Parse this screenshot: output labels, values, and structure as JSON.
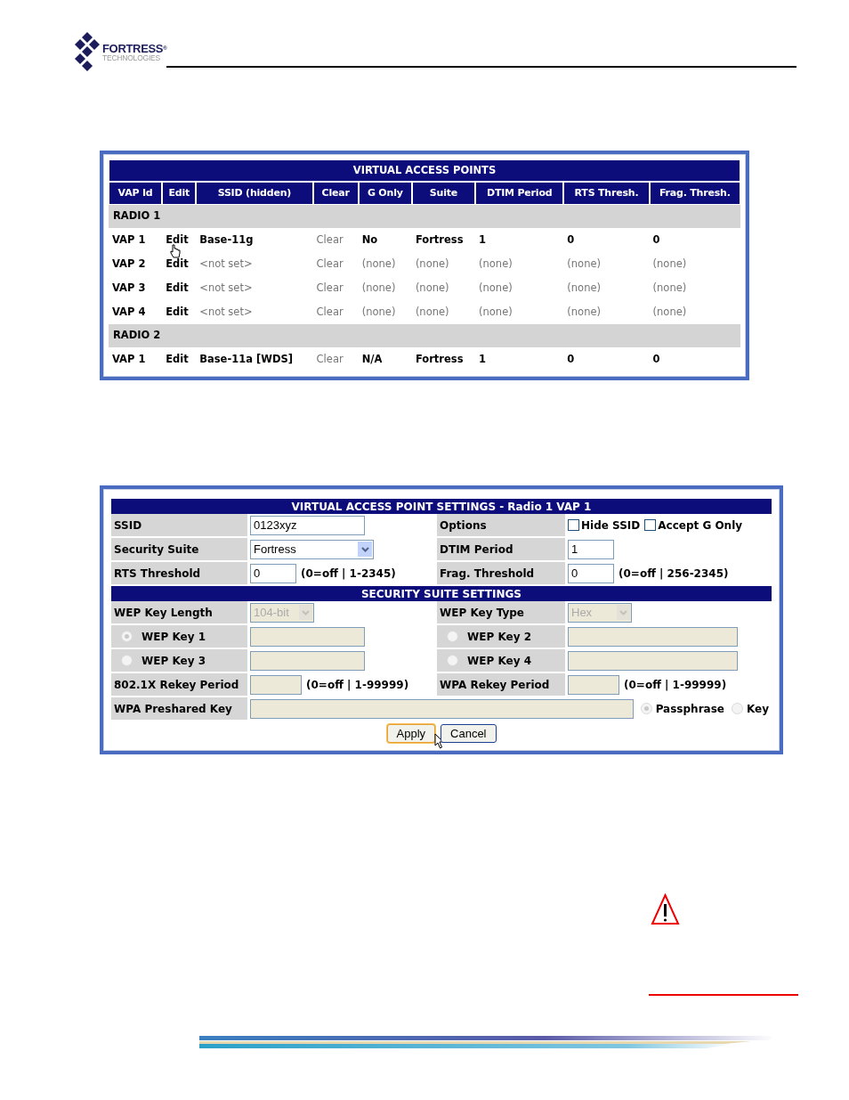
{
  "header": {
    "brand": "FORTRESS",
    "registered": "®",
    "tagline": "TECHNOLOGIES"
  },
  "vap_table": {
    "title": "VIRTUAL ACCESS POINTS",
    "columns": [
      "VAP Id",
      "Edit",
      "SSID (hidden)",
      "Clear",
      "G Only",
      "Suite",
      "DTIM Period",
      "RTS Thresh.",
      "Frag. Thresh."
    ],
    "groups": [
      {
        "label": "RADIO 1",
        "rows": [
          {
            "cells": [
              {
                "text": "VAP 1",
                "dimmed": false
              },
              {
                "text": "Edit",
                "dimmed": false
              },
              {
                "text": "Base-11g",
                "dimmed": false
              },
              {
                "text": "Clear",
                "dimmed": true
              },
              {
                "text": "No",
                "dimmed": false
              },
              {
                "text": "Fortress",
                "dimmed": false
              },
              {
                "text": "1",
                "dimmed": false
              },
              {
                "text": "0",
                "dimmed": false
              },
              {
                "text": "0",
                "dimmed": false
              }
            ]
          },
          {
            "cells": [
              {
                "text": "VAP 2",
                "dimmed": false
              },
              {
                "text": "Edit",
                "dimmed": false
              },
              {
                "text": "<not set>",
                "dimmed": true
              },
              {
                "text": "Clear",
                "dimmed": true
              },
              {
                "text": "(none)",
                "dimmed": true
              },
              {
                "text": "(none)",
                "dimmed": true
              },
              {
                "text": "(none)",
                "dimmed": true
              },
              {
                "text": "(none)",
                "dimmed": true
              },
              {
                "text": "(none)",
                "dimmed": true
              }
            ]
          },
          {
            "cells": [
              {
                "text": "VAP 3",
                "dimmed": false
              },
              {
                "text": "Edit",
                "dimmed": false
              },
              {
                "text": "<not set>",
                "dimmed": true
              },
              {
                "text": "Clear",
                "dimmed": true
              },
              {
                "text": "(none)",
                "dimmed": true
              },
              {
                "text": "(none)",
                "dimmed": true
              },
              {
                "text": "(none)",
                "dimmed": true
              },
              {
                "text": "(none)",
                "dimmed": true
              },
              {
                "text": "(none)",
                "dimmed": true
              }
            ]
          },
          {
            "cells": [
              {
                "text": "VAP 4",
                "dimmed": false
              },
              {
                "text": "Edit",
                "dimmed": false
              },
              {
                "text": "<not set>",
                "dimmed": true
              },
              {
                "text": "Clear",
                "dimmed": true
              },
              {
                "text": "(none)",
                "dimmed": true
              },
              {
                "text": "(none)",
                "dimmed": true
              },
              {
                "text": "(none)",
                "dimmed": true
              },
              {
                "text": "(none)",
                "dimmed": true
              },
              {
                "text": "(none)",
                "dimmed": true
              }
            ]
          }
        ]
      },
      {
        "label": "RADIO 2",
        "rows": [
          {
            "cells": [
              {
                "text": "VAP 1",
                "dimmed": false
              },
              {
                "text": "Edit",
                "dimmed": false
              },
              {
                "text": "Base-11a [WDS]",
                "dimmed": false
              },
              {
                "text": "Clear",
                "dimmed": true
              },
              {
                "text": "N/A",
                "dimmed": false
              },
              {
                "text": "Fortress",
                "dimmed": false
              },
              {
                "text": "1",
                "dimmed": false
              },
              {
                "text": "0",
                "dimmed": false
              },
              {
                "text": "0",
                "dimmed": false
              }
            ]
          }
        ]
      }
    ]
  },
  "settings": {
    "rows": [
      {
        "kind": "heading",
        "text": "VIRTUAL ACCESS POINT SETTINGS - Radio 1 VAP 1"
      },
      {
        "kind": "pair",
        "left": {
          "label": "SSID",
          "control": {
            "kind": "input",
            "value": "0123xyz",
            "disabled": false
          }
        },
        "right": {
          "label": "Options",
          "control": {
            "kind": "checks",
            "options": [
              {
                "label": "Hide SSID",
                "checked": false
              },
              {
                "label": "Accept G Only",
                "checked": false
              }
            ]
          }
        }
      },
      {
        "kind": "pair",
        "left": {
          "label": "Security Suite",
          "control": {
            "kind": "select",
            "value": "Fortress",
            "disabled": false
          }
        },
        "right": {
          "label": "DTIM Period",
          "control": {
            "kind": "number",
            "value": "1",
            "disabled": false
          }
        }
      },
      {
        "kind": "pair",
        "left": {
          "label": "RTS Threshold",
          "control": {
            "kind": "number",
            "value": "0",
            "hint": "(0=off | 1-2345)",
            "disabled": false
          }
        },
        "right": {
          "label": "Frag. Threshold",
          "control": {
            "kind": "number",
            "value": "0",
            "hint": "(0=off | 256-2345)",
            "disabled": false
          }
        }
      },
      {
        "kind": "heading",
        "text": "SECURITY SUITE SETTINGS"
      },
      {
        "kind": "pair",
        "left": {
          "label": "WEP Key Length",
          "control": {
            "kind": "small_select",
            "value": "104-bit",
            "disabled": true
          }
        },
        "right": {
          "label": "WEP Key Type",
          "control": {
            "kind": "small_select",
            "value": "Hex",
            "disabled": true
          }
        }
      },
      {
        "kind": "pair",
        "left": {
          "label": "WEP Key 1",
          "radio": {
            "selected": true,
            "disabled": true
          },
          "control": {
            "kind": "input",
            "disabled": true
          }
        },
        "right": {
          "label": "WEP Key 2",
          "radio": {
            "selected": false,
            "disabled": true
          },
          "control": {
            "kind": "input",
            "disabled": true
          }
        }
      },
      {
        "kind": "pair",
        "left": {
          "label": "WEP Key 3",
          "radio": {
            "selected": false,
            "disabled": true
          },
          "control": {
            "kind": "input",
            "disabled": true
          }
        },
        "right": {
          "label": "WEP Key 4",
          "radio": {
            "selected": false,
            "disabled": true
          },
          "control": {
            "kind": "input",
            "disabled": true
          }
        }
      },
      {
        "kind": "pair",
        "left": {
          "label": "802.1X Rekey Period",
          "control": {
            "kind": "number",
            "hint": "(0=off | 1-99999)",
            "disabled": true
          }
        },
        "right": {
          "label": "WPA Rekey Period",
          "control": {
            "kind": "number",
            "hint": "(0=off | 1-99999)",
            "disabled": true
          }
        }
      },
      {
        "kind": "wide",
        "label": "WPA Preshared Key",
        "disabled": true,
        "radios": [
          {
            "label": "Passphrase",
            "selected": true,
            "disabled": true
          },
          {
            "label": "Key",
            "selected": false,
            "disabled": true
          }
        ]
      },
      {
        "kind": "buttons",
        "buttons": [
          {
            "label": "Apply",
            "focused": true
          },
          {
            "label": "Cancel",
            "focused": false
          }
        ]
      }
    ]
  }
}
